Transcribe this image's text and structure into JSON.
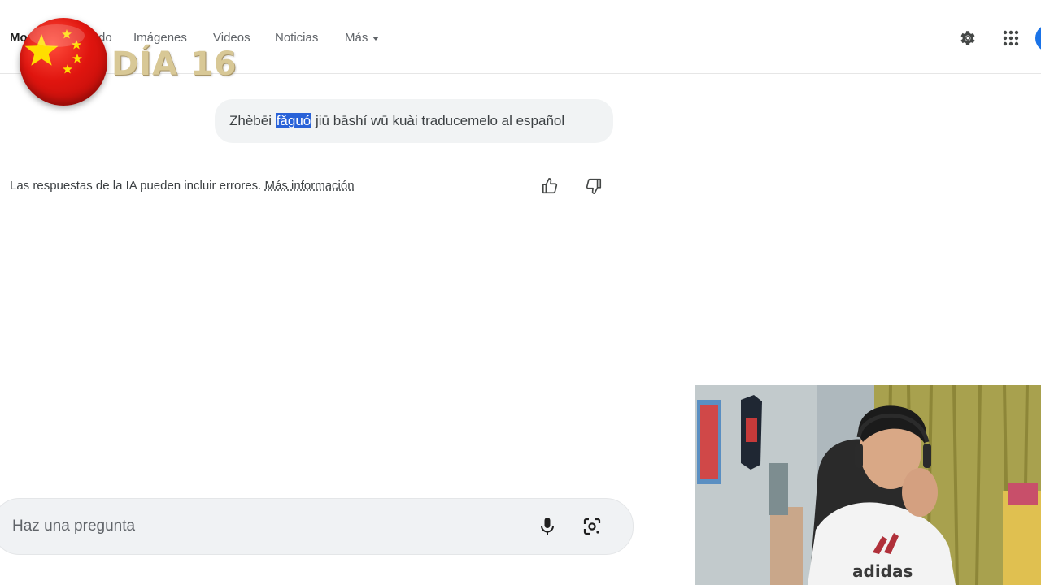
{
  "nav": {
    "tabs": [
      {
        "label": "Mo"
      },
      {
        "label": "do"
      },
      {
        "label": "Imágenes"
      },
      {
        "label": "Videos"
      },
      {
        "label": "Noticias"
      },
      {
        "label": "Más"
      }
    ],
    "icons": [
      "gear-icon",
      "apps-grid-icon",
      "account-avatar"
    ]
  },
  "overlay": {
    "day_label": "DÍA 16",
    "flag": "china-flag"
  },
  "conversation": {
    "query_before": "Zhèbēi ",
    "query_highlight": "fǎguó",
    "query_after": " jiū bāshí wū kuài traducemelo al español",
    "disclaimer": "Las respuestas de la IA pueden incluir errores. ",
    "disclaimer_link": "Más información"
  },
  "ask": {
    "placeholder": "Haz una pregunta"
  },
  "colors": {
    "highlight": "#2962d8",
    "flag_red": "#de2910",
    "flag_yellow": "#ffde00",
    "overlay_text": "#d8c896"
  }
}
